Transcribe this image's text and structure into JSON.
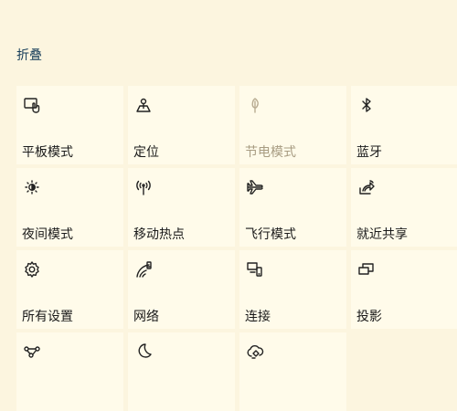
{
  "collapse_label": "折叠",
  "tiles": [
    {
      "label": "平板模式",
      "icon": "tablet-mode-icon"
    },
    {
      "label": "定位",
      "icon": "location-icon"
    },
    {
      "label": "节电模式",
      "icon": "battery-saver-icon",
      "disabled": true
    },
    {
      "label": "蓝牙",
      "icon": "bluetooth-icon"
    },
    {
      "label": "夜间模式",
      "icon": "night-light-icon"
    },
    {
      "label": "移动热点",
      "icon": "mobile-hotspot-icon"
    },
    {
      "label": "飞行模式",
      "icon": "airplane-icon"
    },
    {
      "label": "就近共享",
      "icon": "nearby-share-icon"
    },
    {
      "label": "所有设置",
      "icon": "gear-icon"
    },
    {
      "label": "网络",
      "icon": "network-icon"
    },
    {
      "label": "连接",
      "icon": "connect-icon"
    },
    {
      "label": "投影",
      "icon": "project-icon"
    },
    {
      "label": "",
      "icon": "vpn-icon"
    },
    {
      "label": "",
      "icon": "moon-icon"
    },
    {
      "label": "",
      "icon": "focus-assist-icon"
    }
  ]
}
